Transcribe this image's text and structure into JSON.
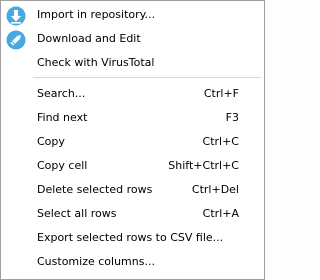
{
  "menu": {
    "items": [
      {
        "label": "Import in repository...",
        "icon": "import-arrow-icon"
      },
      {
        "label": "Download and Edit",
        "icon": "pencil-icon"
      },
      {
        "label": "Check with VirusTotal"
      },
      {
        "label": "Search...",
        "shortcut": "Ctrl+F"
      },
      {
        "label": "Find next",
        "shortcut": "F3"
      },
      {
        "label": "Copy",
        "shortcut": "Ctrl+C"
      },
      {
        "label": "Copy cell",
        "shortcut": "Shift+Ctrl+C"
      },
      {
        "label": "Delete selected rows",
        "shortcut": "Ctrl+Del"
      },
      {
        "label": "Select all rows",
        "shortcut": "Ctrl+A"
      },
      {
        "label": "Export selected rows to CSV file..."
      },
      {
        "label": "Customize columns..."
      }
    ]
  },
  "colors": {
    "icon_blue": "#4aa8e0",
    "icon_white": "#ffffff"
  }
}
